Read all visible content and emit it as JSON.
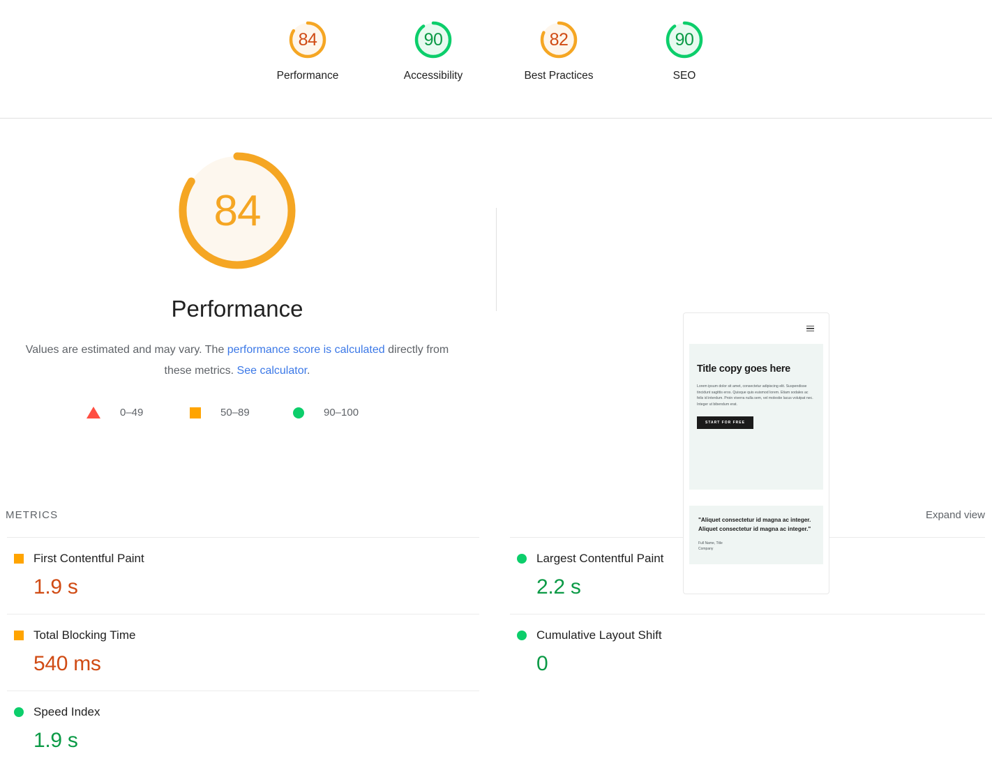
{
  "score_gauges": [
    {
      "score": "84",
      "label": "Performance",
      "rating": "average"
    },
    {
      "score": "90",
      "label": "Accessibility",
      "rating": "pass"
    },
    {
      "score": "82",
      "label": "Best Practices",
      "rating": "average"
    },
    {
      "score": "90",
      "label": "SEO",
      "rating": "pass"
    }
  ],
  "category": {
    "score": "84",
    "title": "Performance",
    "desc_part1": "Values are estimated and may vary. The ",
    "desc_link1": "performance score is calculated",
    "desc_part2": " directly from these metrics. ",
    "desc_link2": "See calculator",
    "desc_part3": "."
  },
  "legend": [
    {
      "icon": "triangle-icon",
      "range": "0–49",
      "color": "#ff4e42"
    },
    {
      "icon": "square-icon",
      "range": "50–89",
      "color": "#ffa400"
    },
    {
      "icon": "circle-icon",
      "range": "90–100",
      "color": "#0cce6b"
    }
  ],
  "thumbnail": {
    "menu_icon": "hamburger-icon",
    "hero_title": "Title copy goes here",
    "hero_body": "Lorem ipsum dolor sit amet, consectetur adipiscing elit. Suspendisse tincidunt sagittis eros. Quisque quis euismod lorem. Etiam sodales ac felis id interdum. Proin viverra nulla sem, vel molestie lacus volutpat nec. Integer ut bibendum erat.",
    "cta_label": "START FOR FREE",
    "quote": "\"Aliquet consectetur id magna ac integer. Aliquet consectetur id magna ac integer.\"",
    "attrib_line1": "Full Name, Title",
    "attrib_line2": "Company"
  },
  "metrics_header": {
    "title": "METRICS",
    "expand_label": "Expand view"
  },
  "metrics": {
    "left": [
      {
        "name": "First Contentful Paint",
        "value": "1.9 s",
        "rating": "average"
      },
      {
        "name": "Total Blocking Time",
        "value": "540 ms",
        "rating": "average"
      },
      {
        "name": "Speed Index",
        "value": "1.9 s",
        "rating": "pass"
      }
    ],
    "right": [
      {
        "name": "Largest Contentful Paint",
        "value": "2.2 s",
        "rating": "pass"
      },
      {
        "name": "Cumulative Layout Shift",
        "value": "0",
        "rating": "pass"
      }
    ]
  },
  "colors": {
    "pass": "#0cce6b",
    "average": "#ffa400",
    "fail": "#ff4e42",
    "pass_text": "#0b9a46",
    "average_text": "#d04b14",
    "link": "#3b78e7"
  }
}
